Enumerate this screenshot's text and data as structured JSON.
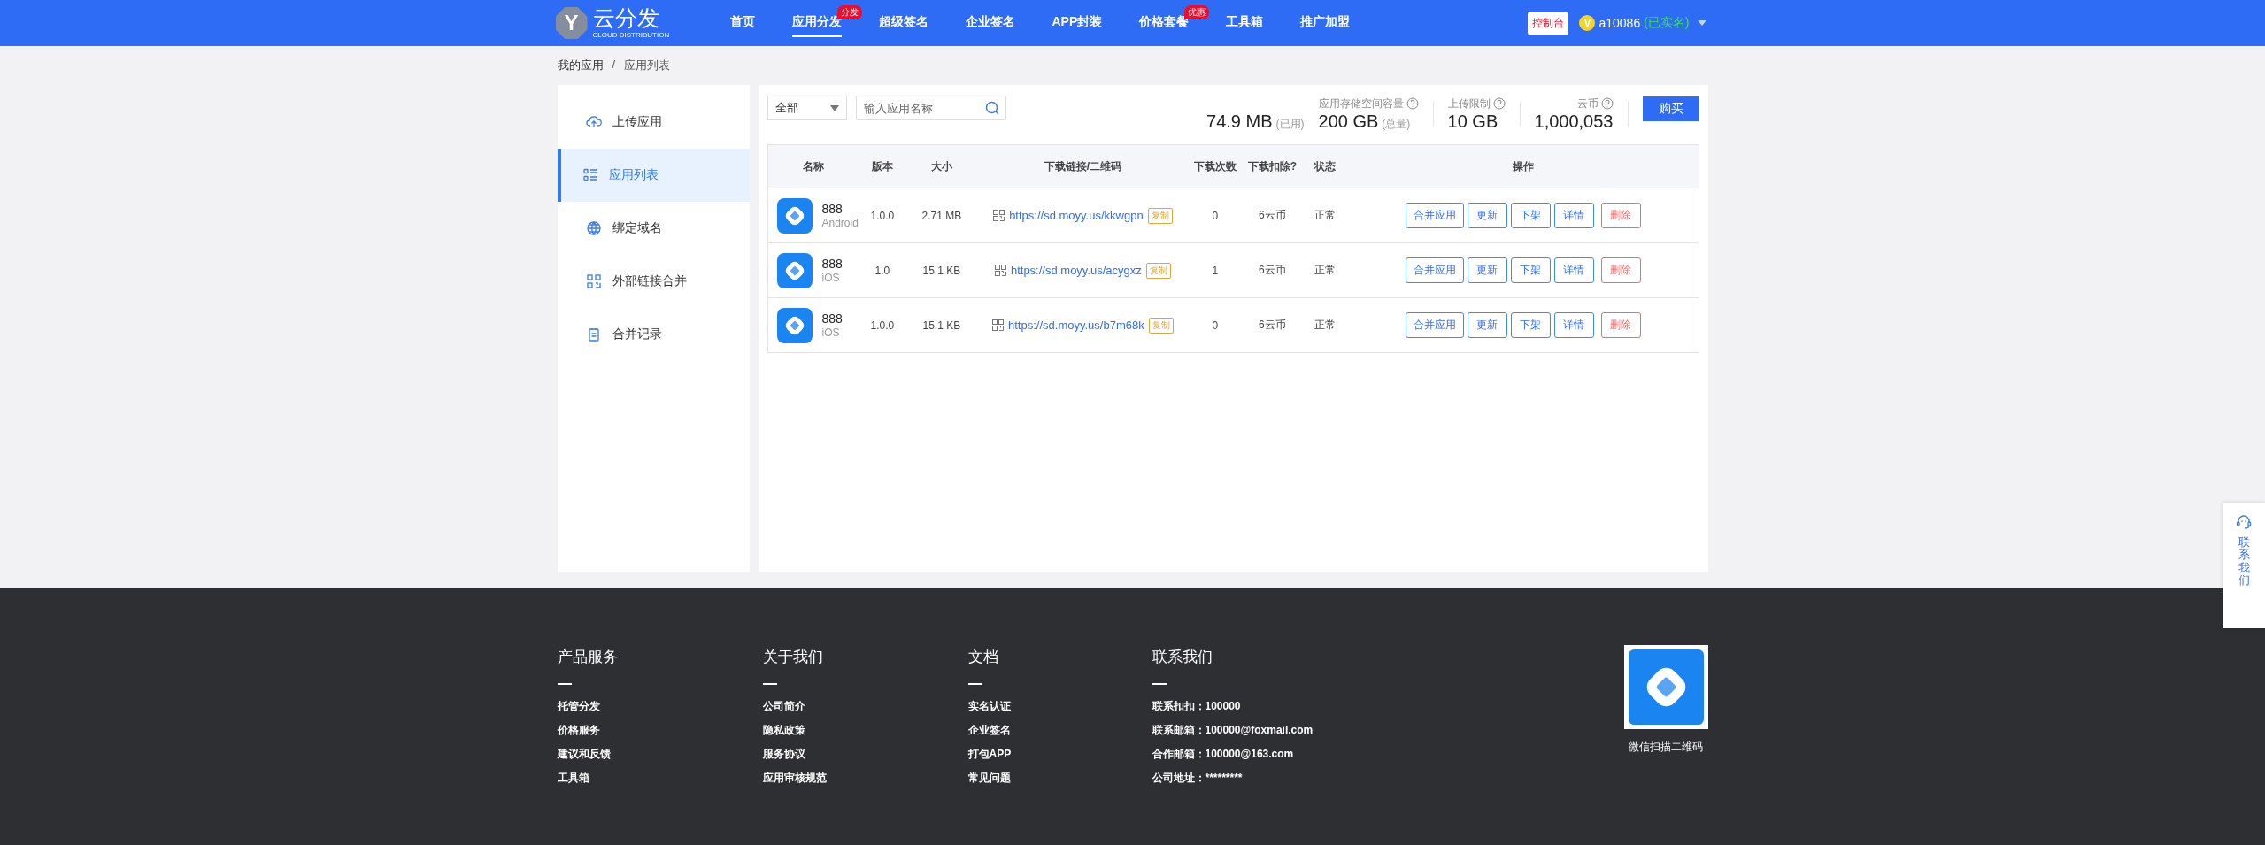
{
  "header": {
    "logo": {
      "letter": "Y",
      "title": "云分发",
      "subtitle": "CLOUD DISTRIBUTION"
    },
    "nav": [
      {
        "label": "首页",
        "selected": false
      },
      {
        "label": "应用分发",
        "selected": true,
        "badge": "分发"
      },
      {
        "label": "超级签名",
        "selected": false
      },
      {
        "label": "企业签名",
        "selected": false
      },
      {
        "label": "APP封装",
        "selected": false
      },
      {
        "label": "价格套餐",
        "selected": false,
        "badge": "优惠"
      },
      {
        "label": "工具箱",
        "selected": false
      },
      {
        "label": "推广加盟",
        "selected": false
      }
    ],
    "console_button": "控制台",
    "user": {
      "initial": "V",
      "name": "a10086",
      "verified": "(已实名)"
    }
  },
  "breadcrumb": [
    "我的应用",
    "/",
    "应用列表"
  ],
  "sidebar": {
    "items": [
      {
        "kind": "upload",
        "label": "上传应用",
        "selected": false
      },
      {
        "kind": "list",
        "label": "应用列表",
        "selected": true
      },
      {
        "kind": "globe",
        "label": "绑定域名",
        "selected": false
      },
      {
        "kind": "grid",
        "label": "外部链接合并",
        "selected": false
      },
      {
        "kind": "clipboard",
        "label": "合并记录",
        "selected": false
      }
    ]
  },
  "toolbar": {
    "filter": "全部",
    "search": {
      "placeholder": "输入应用名称"
    }
  },
  "stats": {
    "used": "74.9 MB",
    "used_note": "(已用)",
    "capacity_label": "应用存储空间容量",
    "capacity": "200 GB",
    "capacity_note": "(总量)",
    "upload_label": "上传限制",
    "upload": "10 GB",
    "coins_label": "云币",
    "coins": "1,000,053",
    "buy_button": "购买"
  },
  "table": {
    "columns": [
      "名称",
      "版本",
      "大小",
      "下载链接/二维码",
      "下载次数",
      "下载扣除?",
      "状态",
      "操作"
    ],
    "rows": [
      {
        "name": "888",
        "platform": "Android",
        "version": "1.0.0",
        "size": "2.71 MB",
        "link": "https://sd.moyy.us/kkwgpn",
        "copy": "复制",
        "downloads": "0",
        "deduct": "6云币",
        "status": "正常",
        "actions": [
          {
            "kind": "normal",
            "label": "合并应用"
          },
          {
            "kind": "normal",
            "label": "更新"
          },
          {
            "kind": "normal",
            "label": "下架"
          },
          {
            "kind": "normal",
            "label": "详情"
          },
          {
            "kind": "danger",
            "label": "删除"
          }
        ]
      },
      {
        "name": "888",
        "platform": "iOS",
        "version": "1.0",
        "size": "15.1 KB",
        "link": "https://sd.moyy.us/acygxz",
        "copy": "复制",
        "downloads": "1",
        "deduct": "6云币",
        "status": "正常",
        "actions": [
          {
            "kind": "normal",
            "label": "合并应用"
          },
          {
            "kind": "normal",
            "label": "更新"
          },
          {
            "kind": "normal",
            "label": "下架"
          },
          {
            "kind": "normal",
            "label": "详情"
          },
          {
            "kind": "danger",
            "label": "删除"
          }
        ]
      },
      {
        "name": "888",
        "platform": "iOS",
        "version": "1.0.0",
        "size": "15.1 KB",
        "link": "https://sd.moyy.us/b7m68k",
        "copy": "复制",
        "downloads": "0",
        "deduct": "6云币",
        "status": "正常",
        "actions": [
          {
            "kind": "normal",
            "label": "合并应用"
          },
          {
            "kind": "normal",
            "label": "更新"
          },
          {
            "kind": "normal",
            "label": "下架"
          },
          {
            "kind": "normal",
            "label": "详情"
          },
          {
            "kind": "danger",
            "label": "删除"
          }
        ]
      }
    ]
  },
  "footer": {
    "columns": [
      {
        "title": "产品服务",
        "links": [
          "托管分发",
          "价格服务",
          "建议和反馈",
          "工具箱"
        ]
      },
      {
        "title": "关于我们",
        "links": [
          "公司简介",
          "隐私政策",
          "服务协议",
          "应用审核规范"
        ]
      },
      {
        "title": "文档",
        "links": [
          "实名认证",
          "企业签名",
          "打包APP",
          "常见问题"
        ]
      },
      {
        "title": "联系我们",
        "contacts": [
          {
            "label": "联系扣扣：",
            "value": "100000"
          },
          {
            "label": "联系邮箱：",
            "value": "100000@foxmail.com"
          },
          {
            "label": "合作邮箱：",
            "value": "100000@163.com"
          },
          {
            "label": "公司地址：",
            "value": "*********"
          }
        ]
      }
    ],
    "qr_caption": "微信扫描二维码"
  },
  "contact_tab": {
    "label": "联系我们"
  }
}
